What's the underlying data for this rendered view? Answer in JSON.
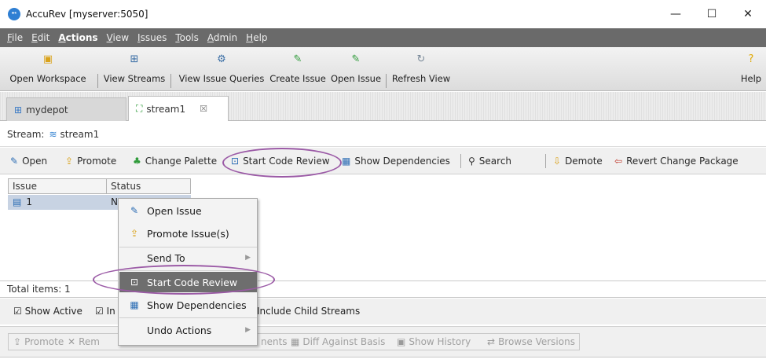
{
  "window": {
    "title": "AccuRev [myserver:5050]",
    "minimize_glyph": "—",
    "maximize_glyph": "☐",
    "close_glyph": "✕"
  },
  "menubar": {
    "items": [
      "File",
      "Edit",
      "Actions",
      "View",
      "Issues",
      "Tools",
      "Admin",
      "Help"
    ],
    "active": "Actions"
  },
  "toolbar": {
    "open_workspace": "Open Workspace",
    "view_streams": "View Streams",
    "view_issue_queries": "View Issue Queries",
    "create_issue": "Create Issue",
    "open_issue": "Open Issue",
    "refresh_view": "Refresh View",
    "help": "Help"
  },
  "tabs": [
    {
      "label": "mydepot",
      "icon": "depot-icon"
    },
    {
      "label": "stream1",
      "icon": "stream-icon",
      "close": "☒"
    }
  ],
  "stream": {
    "prefix": "Stream:",
    "name": "stream1"
  },
  "actions": {
    "open": "Open",
    "promote": "Promote",
    "change_palette": "Change Palette",
    "start_code_review": "Start Code Review",
    "show_dependencies": "Show Dependencies",
    "search": "Search",
    "demote": "Demote",
    "revert_change_package": "Revert Change Package"
  },
  "table": {
    "columns": [
      "Issue",
      "Status"
    ],
    "rows": [
      {
        "issue": "1",
        "status": "N"
      }
    ]
  },
  "total": "Total items: 1",
  "filters": {
    "show_active": "Show Active",
    "second_prefix": "In",
    "include_child_streams": "Include Child Streams"
  },
  "bottom_toolbar": {
    "promote": "Promote",
    "remove_prefix": "Rem",
    "documents_suffix": "nents",
    "diff_against_basis": "Diff Against Basis",
    "show_history": "Show History",
    "browse_versions": "Browse Versions"
  },
  "context_menu": {
    "items": [
      {
        "label": "Open Issue",
        "icon": "open-issue-icon"
      },
      {
        "label": "Promote Issue(s)",
        "icon": "promote-icon"
      },
      {
        "label": "Send To",
        "icon": "",
        "submenu": true
      },
      {
        "label": "Start Code Review",
        "icon": "code-review-icon",
        "highlight": true
      },
      {
        "label": "Show Dependencies",
        "icon": "dependencies-icon"
      },
      {
        "label": "Undo Actions",
        "icon": "",
        "submenu": true
      }
    ]
  },
  "colors": {
    "menubar": "#6a6a6a",
    "highlight": "#6e6e6e",
    "annotation": "#9b5aa6",
    "selected_row": "#c8d3e3"
  }
}
